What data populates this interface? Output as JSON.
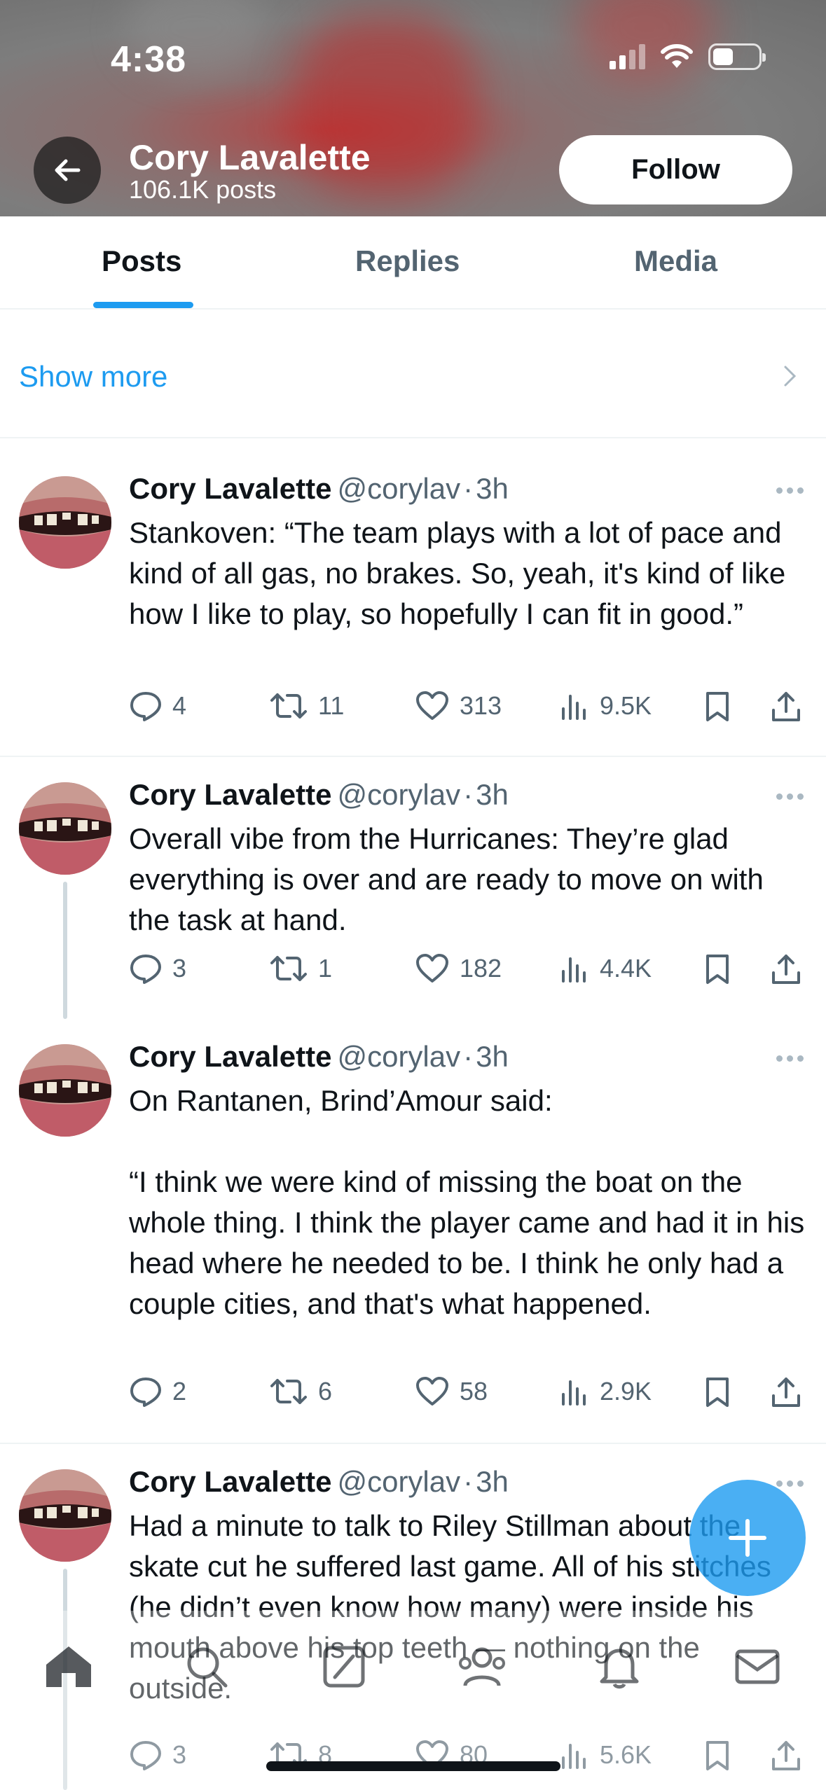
{
  "status_bar": {
    "time": "4:38"
  },
  "profile": {
    "name": "Cory Lavalette",
    "posts_count": "106.1K posts",
    "follow_label": "Follow"
  },
  "tabs": [
    {
      "label": "Posts"
    },
    {
      "label": "Replies"
    },
    {
      "label": "Media"
    }
  ],
  "show_more": {
    "label": "Show more"
  },
  "tweets": [
    {
      "name": "Cory Lavalette",
      "handle": "@corylav",
      "time": "3h",
      "text": "Stankoven: “The team plays with a lot of pace and kind of all gas, no brakes. So, yeah, it's kind of like how I like to play, so hopefully I can fit in good.”",
      "replies": "4",
      "reposts": "11",
      "likes": "313",
      "views": "9.5K"
    },
    {
      "name": "Cory Lavalette",
      "handle": "@corylav",
      "time": "3h",
      "text": "Overall vibe from the Hurricanes: They’re glad everything is over and are ready to move on with the task at hand.",
      "replies": "3",
      "reposts": "1",
      "likes": "182",
      "views": "4.4K"
    },
    {
      "name": "Cory Lavalette",
      "handle": "@corylav",
      "time": "3h",
      "text": "On Rantanen, Brind’Amour said:\n\n“I think we were kind of missing the boat on the whole thing. I think the player came and had it in his head where he needed to be. I think he only had a couple cities, and that's what happened.",
      "replies": "2",
      "reposts": "6",
      "likes": "58",
      "views": "2.9K"
    },
    {
      "name": "Cory Lavalette",
      "handle": "@corylav",
      "time": "3h",
      "text": "Had a minute to talk to Riley Stillman about the skate cut he suffered last game. All of his stitches (he didn’t even know how many) were inside his mouth above his top teeth — nothing on the outside.",
      "replies": "3",
      "reposts": "8",
      "likes": "80",
      "views": "5.6K"
    }
  ],
  "colors": {
    "accent": "#1d9bf0",
    "text": "#0f1419",
    "muted": "#536471"
  }
}
